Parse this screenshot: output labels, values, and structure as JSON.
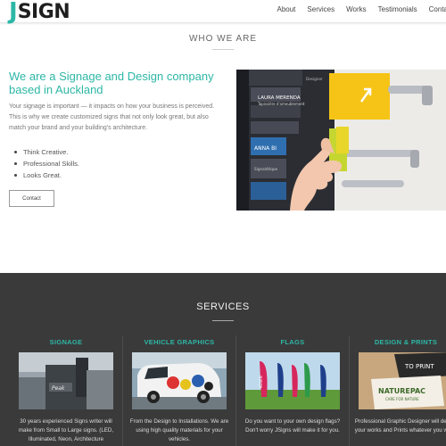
{
  "brand": {
    "logo_j": "J",
    "logo_rest": "SIGN",
    "accent": "#2db7a6"
  },
  "nav": {
    "items": [
      "About",
      "Services",
      "Works",
      "Testimonials",
      "Contac"
    ]
  },
  "who": {
    "title": "WHO WE ARE",
    "headline": "We are a Signage and Design company based in Auckland",
    "intro": "Your signage is important — it impacts on how your business is perceived. This is why we create customized signs that not only look great, but also match your brand and your building's architecture.",
    "bullets": [
      "Think Creative.",
      "Professional Skills.",
      "Looks Great."
    ],
    "contact_label": "Contact"
  },
  "hero_image": {
    "sign_texts": [
      "LAURA MERENDA",
      "Tapissière d'ameublement",
      "ANNA BI",
      "Signalétique",
      "Designer"
    ]
  },
  "services": {
    "title": "SERVICES",
    "items": [
      {
        "title": "SIGNAGE",
        "text": "30 years experienced Signs writer will make from Small to Large signs. (LED, Illuminated, Neon, Architecture"
      },
      {
        "title": "VEHICLE GRAPHICS",
        "text": "From the Design to Installations. We are using high quality materials for your vehicles."
      },
      {
        "title": "FLAGS",
        "text": "Do you want to your own design flags? Don't worry JSigns will make it for you."
      },
      {
        "title": "DESIGN & PRINTS",
        "text": "Professional Graphic Designer will design your works and Prints whatever you want."
      }
    ],
    "image_texts": {
      "flag_word": "KOSEN",
      "print_brand": "NATUREPAC",
      "print_sub": "CARE FOR NATURE",
      "print_card": "TO PRINT"
    }
  }
}
